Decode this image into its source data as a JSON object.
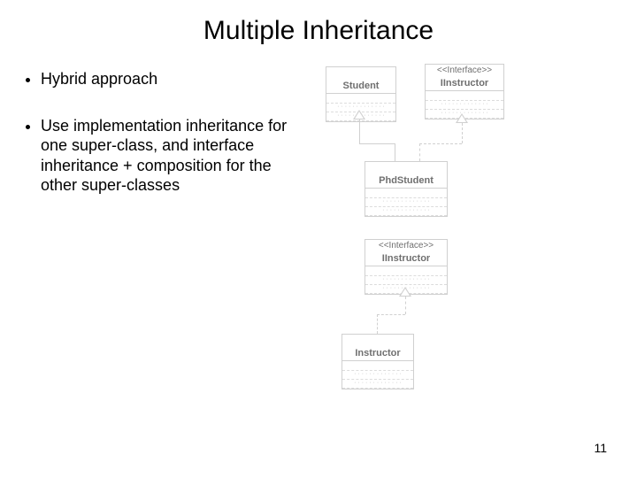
{
  "title": "Multiple Inheritance",
  "bullets": {
    "b1": "Hybrid approach",
    "b2": "Use implementation inheritance for one super-class, and interface inheritance + composition for the other super-classes"
  },
  "page_number": "11",
  "diagram": {
    "stereotype": "<<Interface>>",
    "student": "Student",
    "iinstructor": "IInstructor",
    "phdstudent": "PhdStudent",
    "instructor": "Instructor"
  }
}
